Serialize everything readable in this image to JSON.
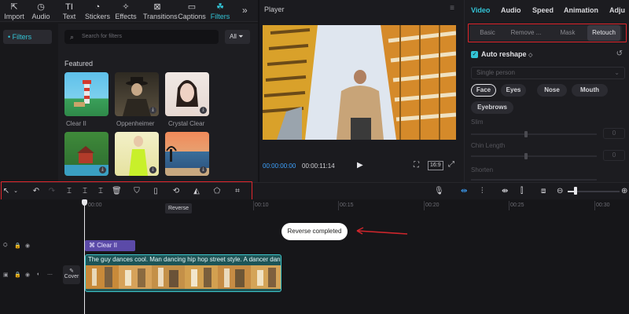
{
  "top_nav": [
    {
      "label": "Import",
      "icon": "import-icon"
    },
    {
      "label": "Audio",
      "icon": "audio-icon"
    },
    {
      "label": "Text",
      "icon": "text-icon"
    },
    {
      "label": "Stickers",
      "icon": "stickers-icon"
    },
    {
      "label": "Effects",
      "icon": "effects-icon"
    },
    {
      "label": "Transitions",
      "icon": "transitions-icon"
    },
    {
      "label": "Captions",
      "icon": "captions-icon"
    },
    {
      "label": "Filters",
      "icon": "filters-icon",
      "active": true
    }
  ],
  "sidebar": {
    "filters_label": "• Filters"
  },
  "filters_panel": {
    "search_placeholder": "Search for filters",
    "all_label": "All",
    "featured_label": "Featured",
    "items": [
      {
        "label": "Clear II"
      },
      {
        "label": "Oppenheimer"
      },
      {
        "label": "Crystal Clear"
      }
    ]
  },
  "player": {
    "title": "Player",
    "current_time": "00:00:00:00",
    "total_time": "00:00:11:14",
    "ratio_label": "16:9"
  },
  "right_panel": {
    "tabs": [
      "Video",
      "Audio",
      "Speed",
      "Animation",
      "Adju"
    ],
    "subtabs": [
      "Basic",
      "Remove ...",
      "Mask",
      "Retouch"
    ],
    "auto_reshape_label": "Auto reshape",
    "person_select": "Single person",
    "face_parts": [
      "Face",
      "Eyes",
      "Nose",
      "Mouth",
      "Eyebrows"
    ],
    "sliders": [
      {
        "label": "Slim",
        "value": "0"
      },
      {
        "label": "Chin Length",
        "value": "0"
      },
      {
        "label": "Shorten",
        "value": ""
      }
    ]
  },
  "timeline": {
    "ticks": [
      "00:00",
      "00:10",
      "00:15",
      "00:20",
      "00:25",
      "00:30"
    ],
    "tooltip": "Reverse",
    "toast": "Reverse completed",
    "fx_clip_label": "Clear II",
    "video_clip_title": "The guy dances cool. Man dancing hip hop street style. A dancer dances",
    "cover_label": "Cover"
  },
  "colors": {
    "accent": "#33c4d6",
    "highlight": "#e0262c",
    "clip": "#3ec5c9",
    "effect_clip": "#5b4aa8"
  }
}
